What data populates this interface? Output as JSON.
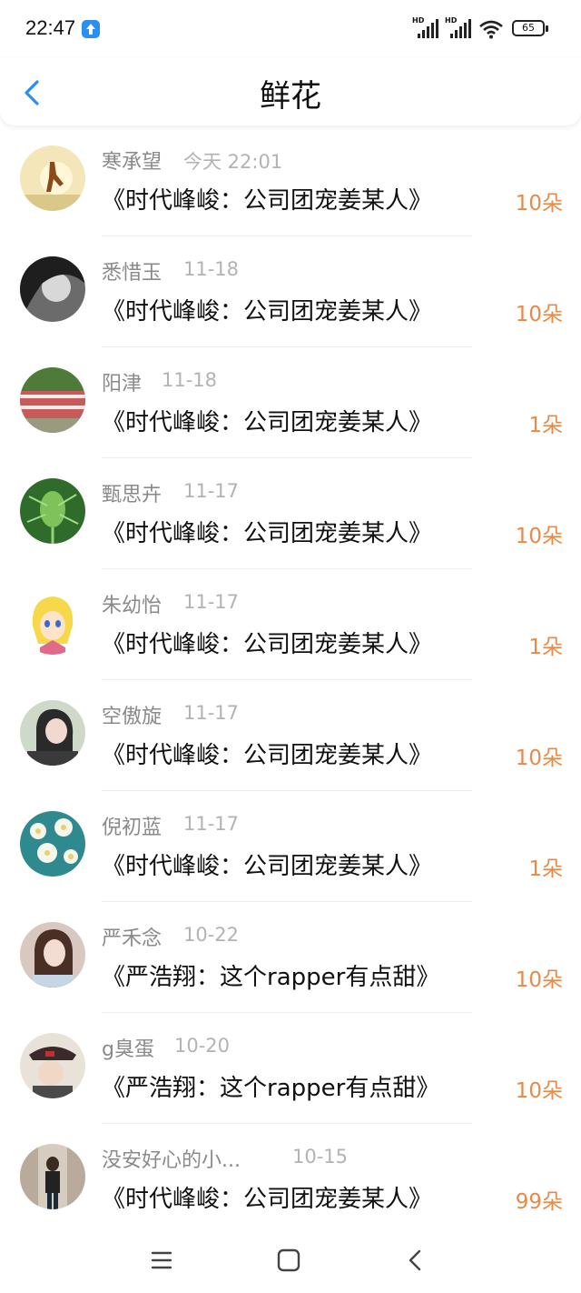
{
  "status": {
    "time": "22:47",
    "hd1": "HD",
    "hd2": "HD",
    "battery": "65"
  },
  "header": {
    "title": "鲜花"
  },
  "list": [
    {
      "name": "寒承望",
      "date": "今天 22:01",
      "book": "《时代峰峻：公司团宠姜某人》",
      "count": "10朵"
    },
    {
      "name": "悉惜玉",
      "date": "11-18",
      "book": "《时代峰峻：公司团宠姜某人》",
      "count": "10朵"
    },
    {
      "name": "阳津",
      "date": "11-18",
      "book": "《时代峰峻：公司团宠姜某人》",
      "count": "1朵"
    },
    {
      "name": "甄思卉",
      "date": "11-17",
      "book": "《时代峰峻：公司团宠姜某人》",
      "count": "10朵"
    },
    {
      "name": "朱幼怡",
      "date": "11-17",
      "book": "《时代峰峻：公司团宠姜某人》",
      "count": "1朵"
    },
    {
      "name": "空傲旋",
      "date": "11-17",
      "book": "《时代峰峻：公司团宠姜某人》",
      "count": "10朵"
    },
    {
      "name": "倪初蓝",
      "date": "11-17",
      "book": "《时代峰峻：公司团宠姜某人》",
      "count": "1朵"
    },
    {
      "name": "严禾念",
      "date": "10-22",
      "book": "《严浩翔：这个rapper有点甜》",
      "count": "10朵"
    },
    {
      "name": "g臭蛋",
      "date": "10-20",
      "book": "《严浩翔：这个rapper有点甜》",
      "count": "10朵"
    },
    {
      "name": "没安好心的小...",
      "date": "10-15",
      "book": "《时代峰峻：公司团宠姜某人》",
      "count": "99朵"
    }
  ],
  "colors": {
    "accent": "#2a8ff0",
    "count": "#e68a4a"
  }
}
